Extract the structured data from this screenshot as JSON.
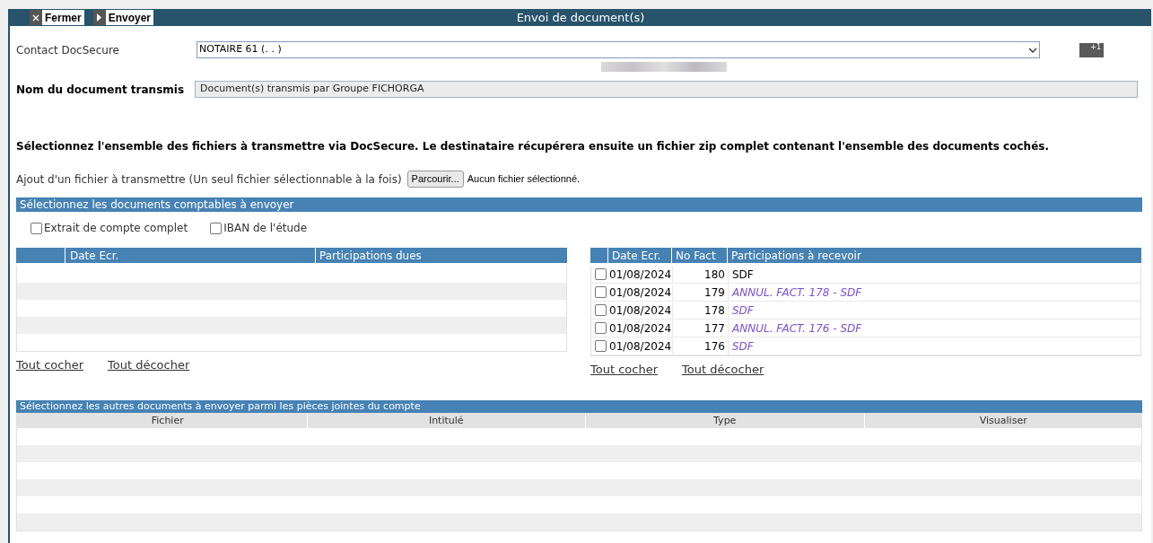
{
  "toolbar": [
    {
      "label": "Fermer"
    },
    {
      "label": "Envoyer"
    }
  ],
  "window": {
    "title": "Envoi de document(s)"
  },
  "contact": {
    "label": "Contact DocSecure",
    "value": "NOTAIRE 61 (. . )",
    "add_button": "+1"
  },
  "document_name": {
    "label": "Nom du document transmis",
    "value": "Document(s) transmis par Groupe FICHORGA"
  },
  "instructions": "Sélectionnez l'ensemble des fichiers à transmettre via DocSecure. Le destinataire récupérera ensuite un fichier zip complet contenant l'ensemble des documents cochés.",
  "file_upload": {
    "label": "Ajout d'un fichier à transmettre (Un seul fichier sélectionnable à la fois)",
    "button": "Parcourir...",
    "status": "Aucun fichier sélectionné."
  },
  "accounting_section": {
    "title": "Sélectionnez les documents comptables à envoyer",
    "options": [
      {
        "label": "Extrait de compte complet",
        "checked": false
      },
      {
        "label": "IBAN de l'étude",
        "checked": false
      }
    ],
    "dues_table": {
      "columns": [
        "Date Ecr.",
        "Participations dues"
      ],
      "links": [
        "Tout cocher",
        "Tout décocher"
      ]
    },
    "receivables_table": {
      "columns": [
        "Date Ecr.",
        "No Fact",
        "Participations à recevoir"
      ],
      "rows": [
        {
          "checked": false,
          "date": "01/08/2024",
          "number": "180",
          "label": "SDF",
          "kind": "invoice"
        },
        {
          "checked": false,
          "date": "01/08/2024",
          "number": "179",
          "label": "ANNUL. FACT. 178 - SDF",
          "kind": "cancellation"
        },
        {
          "checked": false,
          "date": "01/08/2024",
          "number": "178",
          "label": "SDF",
          "kind": "cancellation"
        },
        {
          "checked": false,
          "date": "01/08/2024",
          "number": "177",
          "label": "ANNUL. FACT. 176 - SDF",
          "kind": "cancellation"
        },
        {
          "checked": false,
          "date": "01/08/2024",
          "number": "176",
          "label": "SDF",
          "kind": "cancellation"
        }
      ],
      "links": [
        "Tout cocher",
        "Tout décocher"
      ]
    }
  },
  "attachments_section": {
    "title": "Sélectionnez les autres documents à envoyer parmi les pièces jointes du compte",
    "columns": [
      "Fichier",
      "Intitulé",
      "Type",
      "Visualiser"
    ]
  }
}
